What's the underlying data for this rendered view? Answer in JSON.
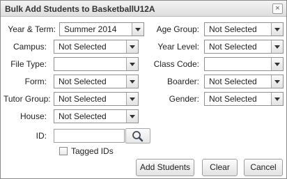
{
  "dialog": {
    "title": "Bulk Add Students to BasketballU12A",
    "close_label": "×"
  },
  "form": {
    "year_term": {
      "label": "Year & Term:",
      "value": "Summer 2014"
    },
    "age_group": {
      "label": "Age Group:",
      "value": "Not Selected"
    },
    "campus": {
      "label": "Campus:",
      "value": "Not Selected"
    },
    "year_level": {
      "label": "Year Level:",
      "value": "Not Selected"
    },
    "file_type": {
      "label": "File Type:",
      "value": ""
    },
    "class_code": {
      "label": "Class Code:",
      "value": ""
    },
    "form": {
      "label": "Form:",
      "value": "Not Selected"
    },
    "boarder": {
      "label": "Boarder:",
      "value": "Not Selected"
    },
    "tutor_group": {
      "label": "Tutor Group:",
      "value": "Not Selected"
    },
    "gender": {
      "label": "Gender:",
      "value": "Not Selected"
    },
    "house": {
      "label": "House:",
      "value": "Not Selected"
    },
    "id": {
      "label": "ID:",
      "value": ""
    },
    "tagged_ids": {
      "label": "Tagged IDs",
      "checked": false
    }
  },
  "buttons": {
    "add_students": "Add Students",
    "clear": "Clear",
    "cancel": "Cancel"
  },
  "icons": {
    "close": "close-icon",
    "search": "search-icon",
    "dropdown": "chevron-down-icon"
  }
}
